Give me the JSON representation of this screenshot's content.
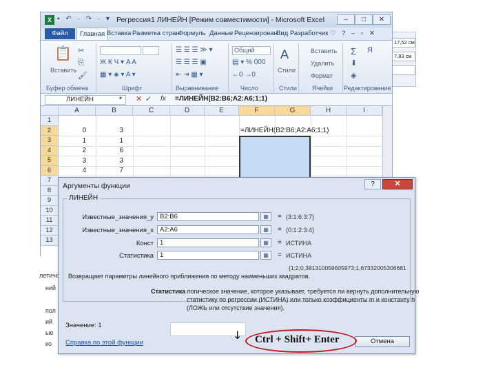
{
  "window": {
    "logo": "X",
    "quick_access": "▪ ↶ · ↷ · ▾",
    "title": "Регрессия1 ЛИНЕЙН [Режим совместимости] - Microsoft Excel",
    "minimize": "–",
    "maximize": "□",
    "close": "✕"
  },
  "ribbon_tabs": {
    "file": "Файл",
    "items": [
      "Главная",
      "Вставка",
      "Разметка стран",
      "Формуль",
      "Данные",
      "Рецензирован",
      "Вид",
      "Разработчик"
    ],
    "extra_icons": "♡ ? – ▫ ✕"
  },
  "ribbon_groups": {
    "clipboard": {
      "label": "Буфер обмена",
      "paste": "Вставить"
    },
    "font": {
      "label": "Шрифт"
    },
    "alignment": {
      "label": "Выравнивание"
    },
    "number": {
      "label": "Число",
      "format": "Общий"
    },
    "styles": {
      "label": "Стили",
      "button": "Стили"
    },
    "cells": {
      "label": "Ячейки",
      "insert": "Вставить",
      "delete": "Удалить",
      "format": "Формат"
    },
    "editing": {
      "label": "Редактирование",
      "sum": "Σ",
      "sort": "Я"
    }
  },
  "formula_bar": {
    "name_box": "ЛИНЕЙН",
    "fx": "fx",
    "formula": "=ЛИНЕЙН(B2:B6;A2:A6;1;1)"
  },
  "sheet": {
    "columns": [
      "A",
      "B",
      "C",
      "D",
      "E",
      "F",
      "G",
      "H",
      "I"
    ],
    "rows": [
      "1",
      "2",
      "3",
      "4",
      "5",
      "6",
      "7",
      "8",
      "9",
      "10",
      "11",
      "12",
      "13"
    ],
    "A": [
      "0",
      "1",
      "2",
      "3",
      "4"
    ],
    "B": [
      "3",
      "1",
      "6",
      "3",
      "7"
    ],
    "edit_formula": "=ЛИНЕЙН(B2:B6;A2:A6;1;1)"
  },
  "side_panel": {
    "items": [
      "17,52 см",
      "7,83 см",
      ""
    ]
  },
  "background_fragments": [
    "летичес",
    "ний",
    "пол",
    "ий",
    "ые",
    "ко"
  ],
  "dialog": {
    "title": "Аргументы функции",
    "help": "?",
    "close": "✕",
    "function_name": "ЛИНЕЙН",
    "args": [
      {
        "label": "Известные_значения_y",
        "value": "B2:B6",
        "result": "{3:1:6:3:7}"
      },
      {
        "label": "Известные_значения_x",
        "value": "A2:A6",
        "result": "{0:1:2:3:4}"
      },
      {
        "label": "Конст",
        "value": "1",
        "result": "ИСТИНА"
      },
      {
        "label": "Статистика",
        "value": "1",
        "result": "ИСТИНА"
      }
    ],
    "result_array": "{1;2;0,381310059605973;1,67332005306681",
    "description": "Возвращает параметры линейного приближения по методу наименьших квадратов.",
    "stat_label": "Статистика",
    "stat_desc_1": "логическое значение, которое указывает, требуется ли вернуть дополнительную",
    "stat_desc_2": "статистику по регрессии (ИСТИНА) или только коэффициенты m и константу b",
    "stat_desc_3": "(ЛОЖЬ или отсутствие значения).",
    "value_label": "Значение: 1",
    "help_link": "Справка по этой функции",
    "cancel": "Отмена"
  },
  "annotation": {
    "arrow": "↓",
    "text": "Ctrl + Shift+ Enter",
    "color": "#c0151d"
  }
}
